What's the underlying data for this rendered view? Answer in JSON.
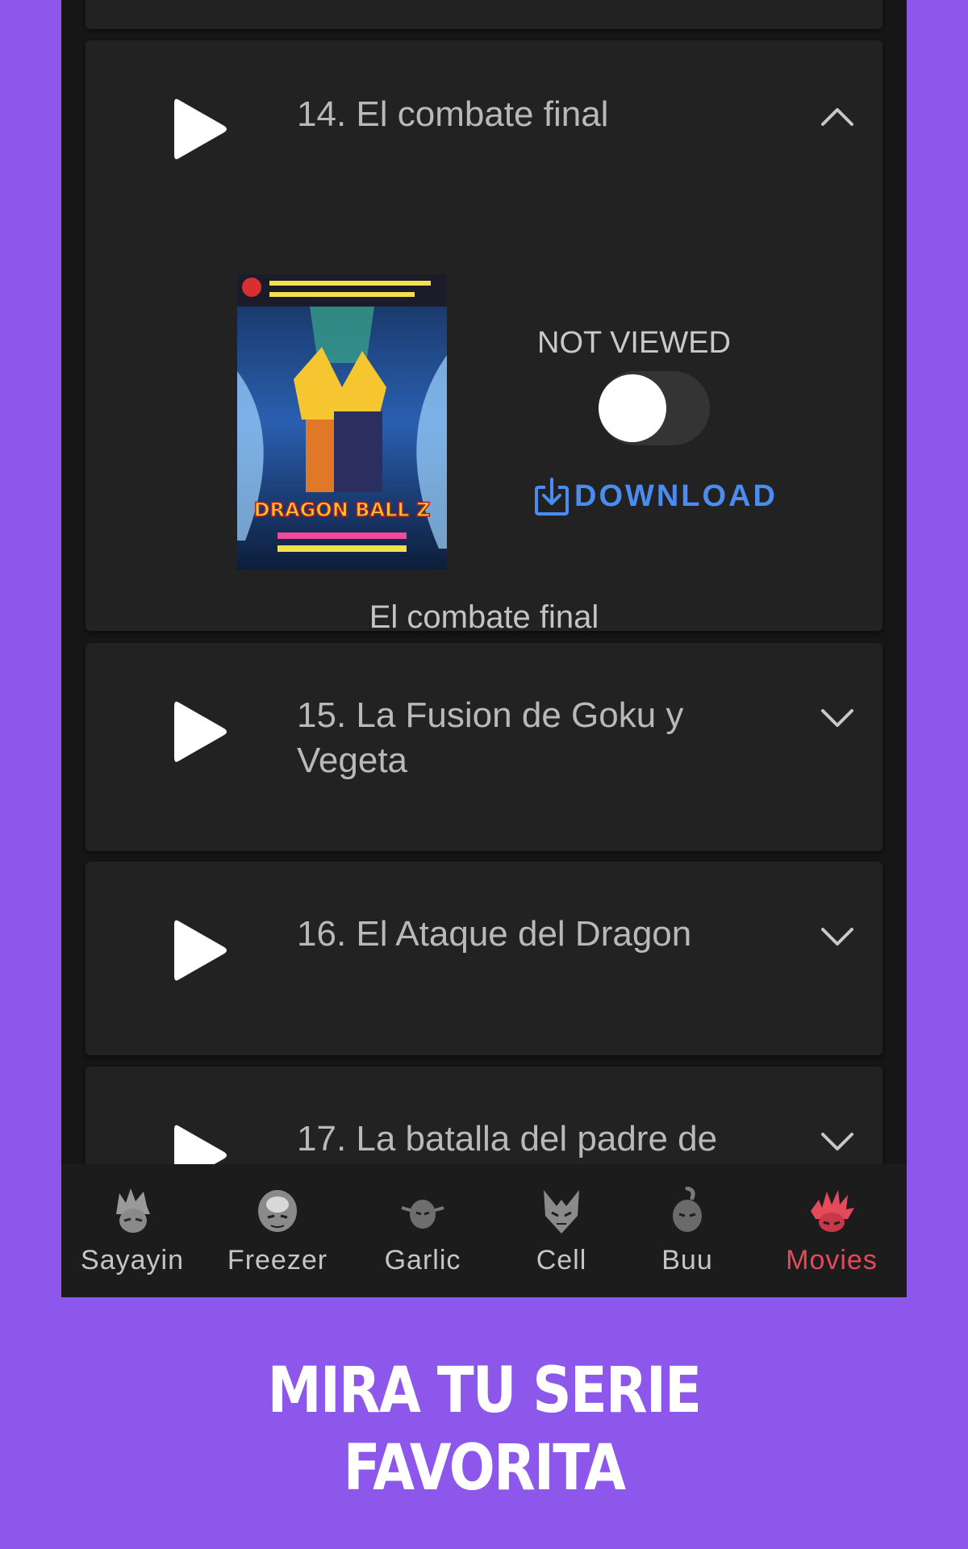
{
  "episodes": [
    {
      "title": "14. El combate final",
      "expanded": true,
      "status_label": "NOT VIEWED",
      "viewed": false,
      "download_label": "DOWNLOAD",
      "caption": "El combate final",
      "poster_text": "DRAGON BALL Z"
    },
    {
      "title": "15. La Fusion de Goku y Vegeta",
      "expanded": false
    },
    {
      "title": "16. El Ataque del Dragon",
      "expanded": false
    },
    {
      "title": "17. La batalla del padre de",
      "expanded": false
    }
  ],
  "nav": [
    {
      "label": "Sayayin",
      "icon": "sayayin-icon",
      "active": false
    },
    {
      "label": "Freezer",
      "icon": "freezer-icon",
      "active": false
    },
    {
      "label": "Garlic",
      "icon": "garlic-icon",
      "active": false
    },
    {
      "label": "Cell",
      "icon": "cell-icon",
      "active": false
    },
    {
      "label": "Buu",
      "icon": "buu-icon",
      "active": false
    },
    {
      "label": "Movies",
      "icon": "movies-icon",
      "active": true
    }
  ],
  "promo": {
    "line1": "MIRA TU SERIE",
    "line2": "FAVORITA"
  },
  "colors": {
    "background": "#8e57ec",
    "accent": "#4a8cf0",
    "active_tab": "#e44a5a"
  }
}
